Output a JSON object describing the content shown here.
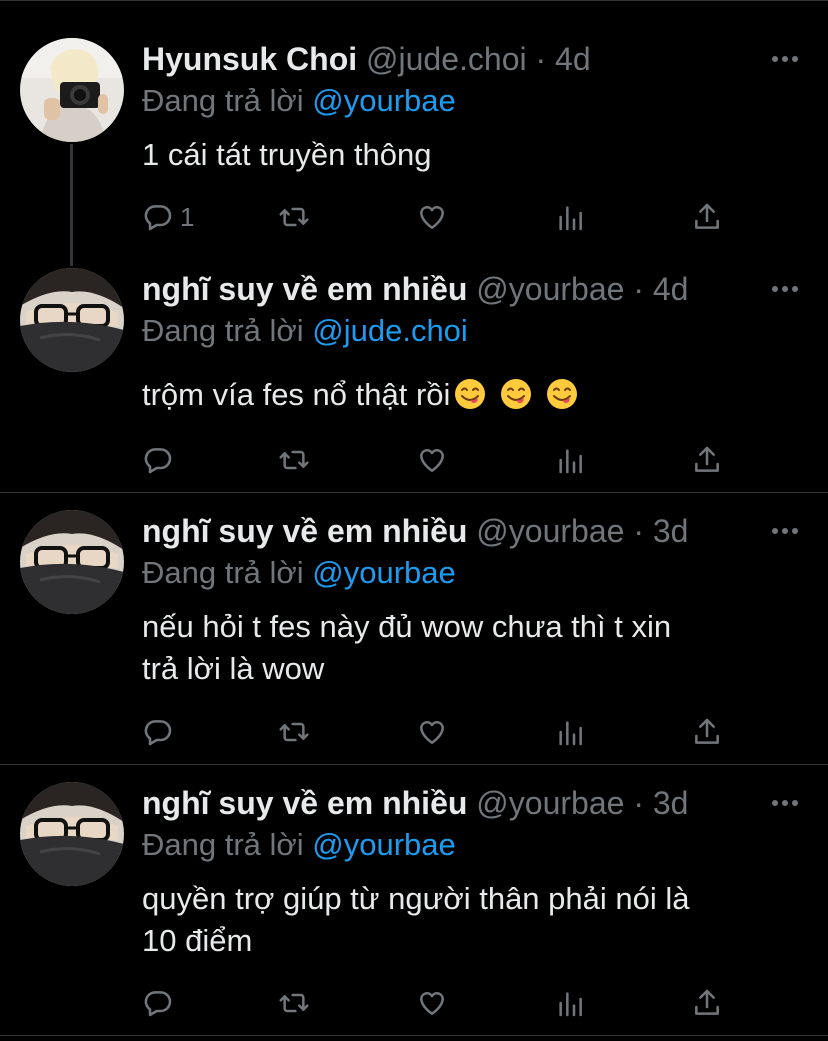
{
  "tweets": [
    {
      "name": "Hyunsuk Choi",
      "handle": "@jude.choi",
      "time": "· 4d",
      "reply_prefix": "Đang trả lời",
      "reply_to": "@yourbae",
      "text": "1 cái tát truyền thông",
      "reply_count": "1",
      "avatar": "avatar-photo-camera"
    },
    {
      "name": "nghĩ suy về em nhiều",
      "handle": "@yourbae",
      "time": "· 4d",
      "reply_prefix": "Đang trả lời",
      "reply_to": "@jude.choi",
      "text": "trộm vía fes nổ thật rồi",
      "emojis": [
        "face-savoring-food-emoji",
        "face-savoring-food-emoji",
        "face-savoring-food-emoji"
      ],
      "avatar": "avatar-glasses"
    },
    {
      "name": "nghĩ suy về em nhiều",
      "handle": "@yourbae",
      "time": "· 3d",
      "reply_prefix": "Đang trả lời",
      "reply_to": "@yourbae",
      "text_lines": [
        "nếu hỏi t fes này đủ wow chưa thì t xin",
        "trả lời là wow"
      ],
      "avatar": "avatar-glasses"
    },
    {
      "name": "nghĩ suy về em nhiều",
      "handle": "@yourbae",
      "time": "· 3d",
      "reply_prefix": "Đang trả lời",
      "reply_to": "@yourbae",
      "text_lines": [
        "quyền trợ giúp từ người thân phải nói là",
        "10 điểm"
      ],
      "avatar": "avatar-glasses"
    }
  ],
  "icons": [
    "reply-icon",
    "retweet-icon",
    "like-icon",
    "analytics-icon",
    "share-icon",
    "more-icon"
  ],
  "colors": {
    "background": "#000000",
    "text": "#e7e9ea",
    "muted": "#71767b",
    "link": "#1d9bf0",
    "divider": "#2f3336"
  }
}
